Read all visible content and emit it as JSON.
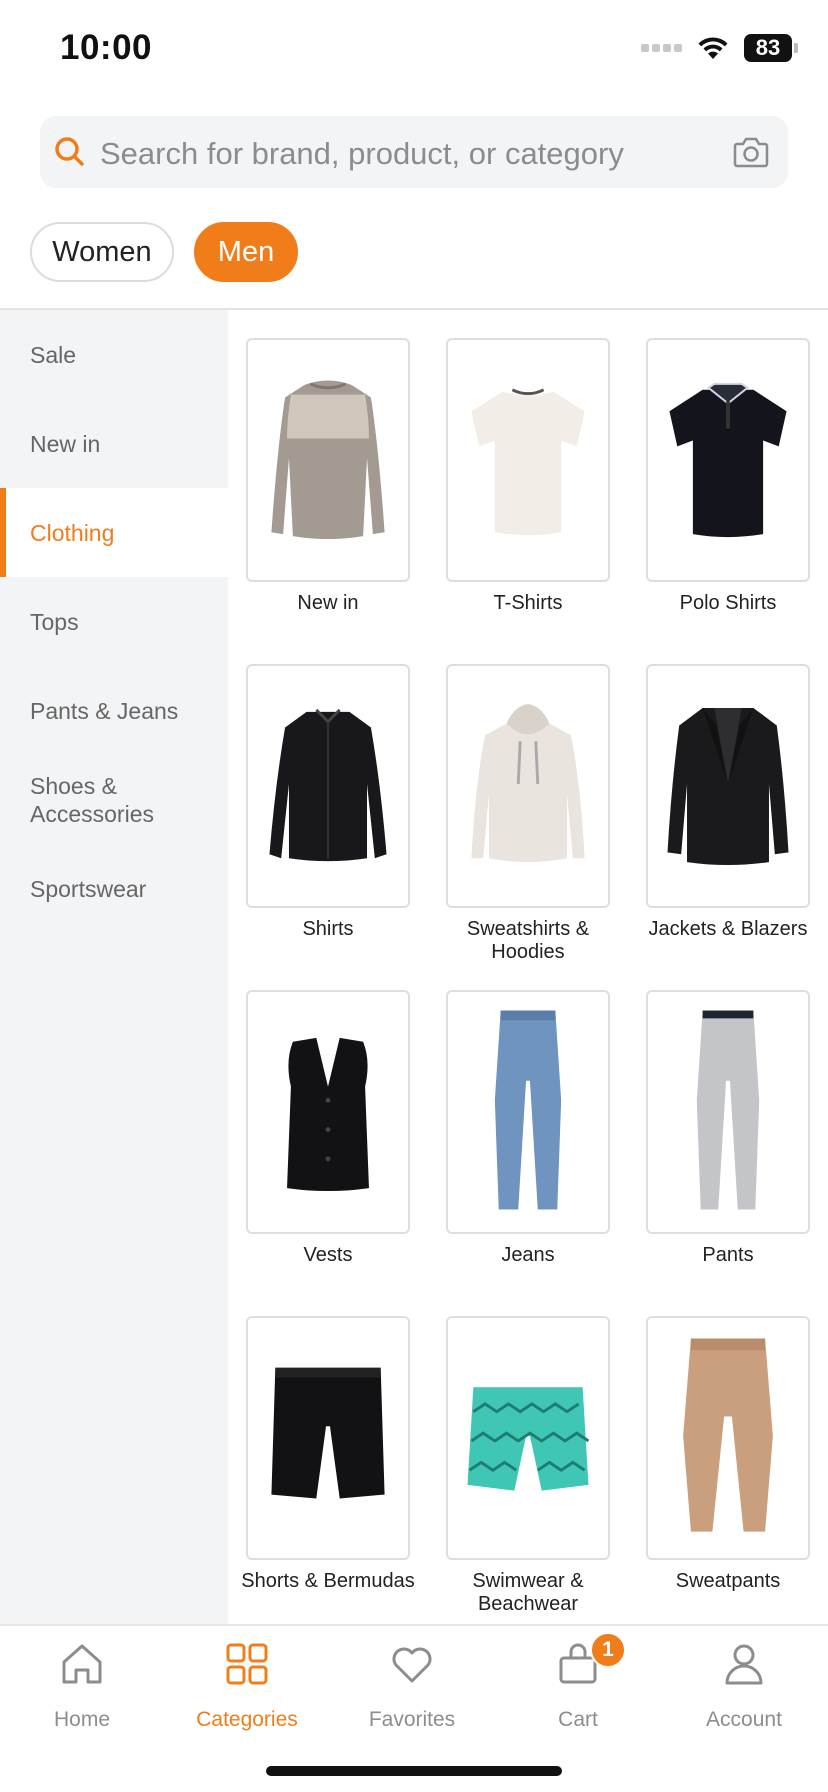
{
  "status_bar": {
    "time": "10:00",
    "battery": "83"
  },
  "search": {
    "placeholder": "Search for brand, product, or category"
  },
  "gender": {
    "women": "Women",
    "men": "Men",
    "selected": "Men"
  },
  "colors": {
    "accent": "#f07d1a",
    "sidebar_bg": "#f3f4f6",
    "text_muted": "#8d8d8d"
  },
  "sidebar": {
    "items": [
      {
        "label": "Sale"
      },
      {
        "label": "New in"
      },
      {
        "label": "Clothing",
        "active": true
      },
      {
        "label": "Tops"
      },
      {
        "label": "Pants & Jeans"
      },
      {
        "label": "Shoes & Accessories"
      },
      {
        "label": "Sportswear"
      }
    ]
  },
  "categories": [
    {
      "label": "New in",
      "icon": "sweater-image"
    },
    {
      "label": "T-Shirts",
      "icon": "tshirt-image"
    },
    {
      "label": "Polo Shirts",
      "icon": "polo-image"
    },
    {
      "label": "Shirts",
      "icon": "shirt-image"
    },
    {
      "label": "Sweatshirts & Hoodies",
      "icon": "hoodie-image"
    },
    {
      "label": "Jackets & Blazers",
      "icon": "blazer-image"
    },
    {
      "label": "Vests",
      "icon": "vest-image"
    },
    {
      "label": "Jeans",
      "icon": "jeans-image"
    },
    {
      "label": "Pants",
      "icon": "pants-image"
    },
    {
      "label": "Shorts & Bermudas",
      "icon": "shorts-image"
    },
    {
      "label": "Swimwear & Beachwear",
      "icon": "swim-shorts-image"
    },
    {
      "label": "Sweatpants",
      "icon": "sweatpants-image"
    }
  ],
  "tab_bar": {
    "tabs": [
      {
        "label": "Home",
        "icon": "home-icon"
      },
      {
        "label": "Categories",
        "icon": "grid-icon",
        "active": true
      },
      {
        "label": "Favorites",
        "icon": "heart-icon"
      },
      {
        "label": "Cart",
        "icon": "cart-icon",
        "badge": "1"
      },
      {
        "label": "Account",
        "icon": "user-icon"
      }
    ]
  }
}
